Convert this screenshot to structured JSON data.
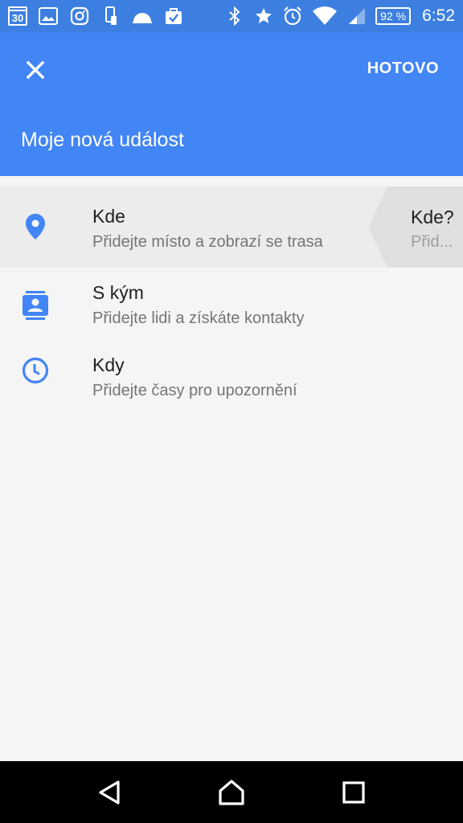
{
  "status_bar": {
    "calendar_day": "30",
    "battery": "92 %",
    "time": "6:52",
    "icons": [
      "calendar-icon",
      "gallery-icon",
      "instagram-icon",
      "phone-transfer-icon",
      "weather-icon",
      "briefcase-icon",
      "bluetooth-icon",
      "star-icon",
      "alarm-icon",
      "wifi-icon",
      "signal-icon",
      "battery-icon"
    ]
  },
  "app_bar": {
    "close_icon": "close-icon",
    "done_label": "HOTOVO",
    "event_title": "Moje nová událost",
    "color": "#4285f4"
  },
  "rows": [
    {
      "icon": "location-pin-icon",
      "title": "Kde",
      "subtitle": "Přidejte místo a zobrazí se trasa"
    },
    {
      "icon": "contacts-icon",
      "title": "S kým",
      "subtitle": "Přidejte lidi a získáte kontakty"
    },
    {
      "icon": "clock-icon",
      "title": "Kdy",
      "subtitle": "Přidejte časy pro upozornění"
    }
  ],
  "suggestion_card": {
    "title": "Kde?",
    "subtitle": "Přid..."
  },
  "nav_bar": {
    "icons": [
      "back-icon",
      "home-icon",
      "recents-icon"
    ]
  }
}
